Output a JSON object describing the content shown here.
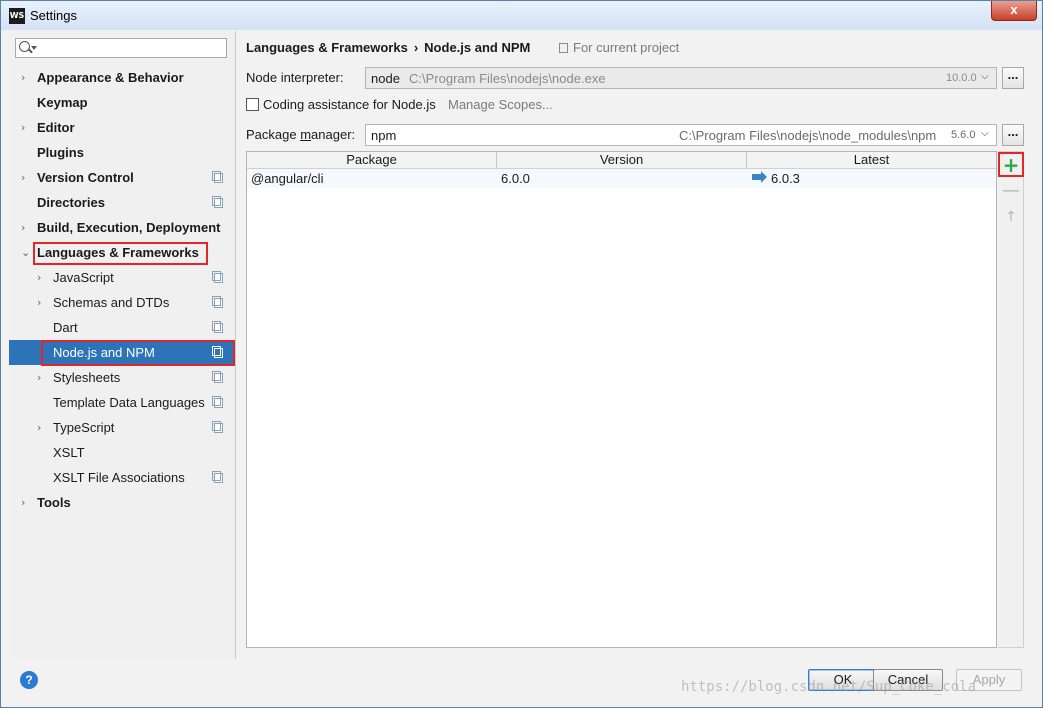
{
  "window": {
    "title": "Settings",
    "app_icon": "WS",
    "close": "x"
  },
  "sidebar": {
    "search_placeholder": "",
    "items": [
      {
        "label": "Appearance & Behavior",
        "top": true,
        "chevron": "right",
        "icon": false
      },
      {
        "label": "Keymap",
        "top": true,
        "chevron": "",
        "icon": false
      },
      {
        "label": "Editor",
        "top": true,
        "chevron": "right",
        "icon": false
      },
      {
        "label": "Plugins",
        "top": true,
        "chevron": "",
        "icon": false
      },
      {
        "label": "Version Control",
        "top": true,
        "chevron": "right",
        "icon": true
      },
      {
        "label": "Directories",
        "top": true,
        "chevron": "",
        "icon": true
      },
      {
        "label": "Build, Execution, Deployment",
        "top": true,
        "chevron": "right",
        "icon": false
      },
      {
        "label": "Languages & Frameworks",
        "top": true,
        "chevron": "down",
        "icon": false
      },
      {
        "label": "JavaScript",
        "top": false,
        "chevron": "right",
        "icon": true
      },
      {
        "label": "Schemas and DTDs",
        "top": false,
        "chevron": "right",
        "icon": true
      },
      {
        "label": "Dart",
        "top": false,
        "chevron": "",
        "icon": true
      },
      {
        "label": "Node.js and NPM",
        "top": false,
        "chevron": "",
        "icon": true,
        "selected": true
      },
      {
        "label": "Stylesheets",
        "top": false,
        "chevron": "right",
        "icon": true
      },
      {
        "label": "Template Data Languages",
        "top": false,
        "chevron": "",
        "icon": true
      },
      {
        "label": "TypeScript",
        "top": false,
        "chevron": "right",
        "icon": true
      },
      {
        "label": "XSLT",
        "top": false,
        "chevron": "",
        "icon": false
      },
      {
        "label": "XSLT File Associations",
        "top": false,
        "chevron": "",
        "icon": true
      },
      {
        "label": "Tools",
        "top": true,
        "chevron": "right",
        "icon": false
      }
    ]
  },
  "main": {
    "breadcrumb": {
      "parent": "Languages & Frameworks",
      "separator": "›",
      "current": "Node.js and NPM"
    },
    "project_note": "For current project",
    "interpreter": {
      "label": "Node interpreter:",
      "value": "node",
      "path": "C:\\Program Files\\nodejs\\node.exe",
      "version": "10.0.0",
      "button": "..."
    },
    "coding_assistance": {
      "label": "Coding assistance for Node.js",
      "checked": false,
      "manage_scopes": "Manage Scopes..."
    },
    "package_manager": {
      "label_pre": "Package ",
      "label_u": "m",
      "label_post": "anager:",
      "value": "npm",
      "path": "C:\\Program Files\\nodejs\\node_modules\\npm",
      "version": "5.6.0",
      "button": "..."
    },
    "table": {
      "columns": [
        "Package",
        "Version",
        "Latest"
      ],
      "rows": [
        {
          "package": "@angular/cli",
          "version": "6.0.0",
          "latest": "6.0.3"
        }
      ]
    },
    "tools": {
      "add": "+",
      "remove": "—",
      "up": "↑"
    }
  },
  "footer": {
    "help": "?",
    "ok": "OK",
    "cancel": "Cancel",
    "apply": "Apply",
    "watermark": "https://blog.csdn.net/Sup_Coke_cola"
  },
  "colors": {
    "accent": "#2d73b8",
    "highlight": "#e0252b",
    "add": "#2ea84d"
  }
}
